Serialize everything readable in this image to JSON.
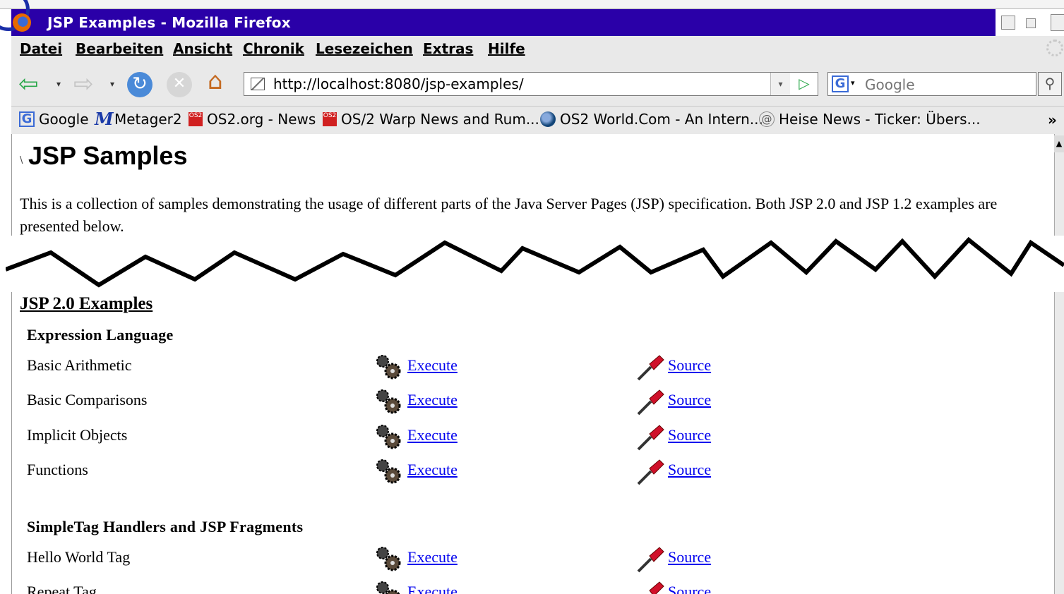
{
  "window": {
    "title": "JSP Examples - Mozilla Firefox"
  },
  "menu": [
    "Datei",
    "Bearbeiten",
    "Ansicht",
    "Chronik",
    "Lesezeichen",
    "Extras",
    "Hilfe"
  ],
  "navigation": {
    "url": "http://localhost:8080/jsp-examples/",
    "search_placeholder": "Google"
  },
  "bookmarks": [
    {
      "label": "Google",
      "icon": "google-icon"
    },
    {
      "label": "Metager2",
      "icon": "metager-icon"
    },
    {
      "label": "OS2.org - News",
      "icon": "os2-icon"
    },
    {
      "label": "OS/2 Warp News and Rum...",
      "icon": "os2-icon"
    },
    {
      "label": "OS2 World.Com - An Intern...",
      "icon": "globe-icon"
    },
    {
      "label": "Heise News - Ticker: Übers...",
      "icon": "at-icon"
    }
  ],
  "bookmarks_more": "»",
  "page": {
    "slash": "\\",
    "title": "JSP Samples",
    "intro": "This is a collection of samples demonstrating the usage of different parts of the Java Server Pages (JSP) specification. Both JSP 2.0 and JSP 1.2 examples are presented below.",
    "section_title": "JSP 2.0 Examples",
    "execute_label": "Execute",
    "source_label": "Source",
    "groups": [
      {
        "title": "Expression Language",
        "rows": [
          "Basic Arithmetic",
          "Basic Comparisons",
          "Implicit Objects",
          "Functions"
        ]
      },
      {
        "title": "SimpleTag Handlers and JSP Fragments",
        "rows": [
          "Hello World Tag",
          "Repeat Tag"
        ]
      }
    ]
  },
  "colors": {
    "titlebar": "#2a00a8",
    "link": "#0000ee",
    "chrome": "#e9e9e9"
  }
}
